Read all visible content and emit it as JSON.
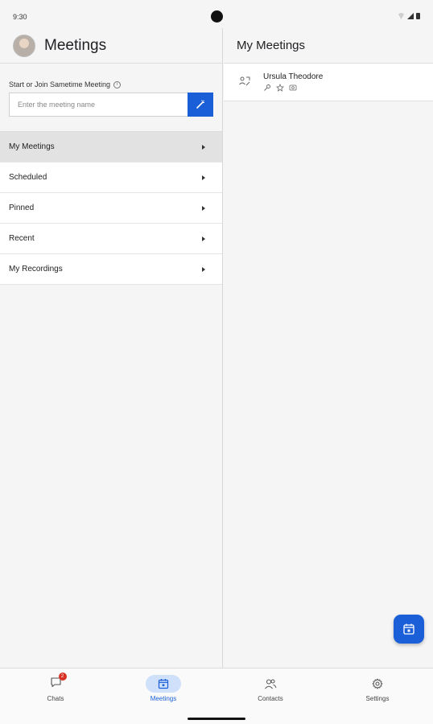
{
  "status_bar": {
    "time": "9:30"
  },
  "left": {
    "title": "Meetings",
    "join": {
      "label": "Start or Join Sametime Meeting",
      "placeholder": "Enter the meeting name"
    },
    "nav_items": [
      {
        "label": "My Meetings",
        "active": true
      },
      {
        "label": "Scheduled"
      },
      {
        "label": "Pinned"
      },
      {
        "label": "Recent"
      },
      {
        "label": "My Recordings"
      }
    ]
  },
  "right": {
    "title": "My Meetings",
    "meetings": [
      {
        "name": "Ursula Theodore"
      }
    ]
  },
  "bottom_nav": {
    "tabs": [
      {
        "label": "Chats",
        "badge": "2"
      },
      {
        "label": "Meetings",
        "active": true
      },
      {
        "label": "Contacts"
      },
      {
        "label": "Settings"
      }
    ]
  },
  "colors": {
    "accent": "#1a5fd8",
    "badge": "#d93025",
    "active_tab_bg": "#cfe0fb"
  }
}
